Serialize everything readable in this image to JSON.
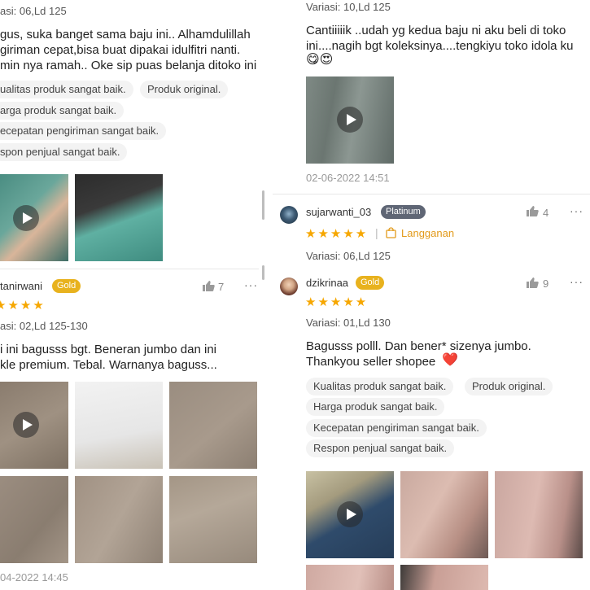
{
  "left_column": {
    "review1": {
      "variation": "asi: 06,Ld 125",
      "text_lines": [
        "gus, suka banget sama baju ini.. Alhamdulillah",
        "giriman cepat,bisa buat dipakai idulfitri nanti.",
        "min nya ramah.. Oke sip puas belanja ditoko ini"
      ],
      "tags": [
        "ualitas produk sangat baik.",
        "Produk original.",
        "arga produk sangat baik.",
        "ecepatan pengiriman sangat baik.",
        "spon penjual sangat baik."
      ]
    },
    "review2": {
      "username": "tanirwani",
      "badge": "Gold",
      "stars": "★★★★",
      "likes": "7",
      "more": "···",
      "variation": "asi: 02,Ld 125-130",
      "text_lines": [
        "i ini bagusss bgt. Beneran jumbo dan ini",
        "kle premium. Tebal. Warnanya baguss..."
      ],
      "timestamp": "04-2022 14:45"
    }
  },
  "right_column": {
    "review1": {
      "variation": "Variasi: 10,Ld 125",
      "text_lines": [
        "Cantiiiiik ..udah yg kedua baju ni aku beli di toko",
        "ini....nagih bgt koleksinya....tengkiyu toko idola ku"
      ],
      "emoji": "😋😍",
      "timestamp": "02-06-2022 14:51"
    },
    "review2": {
      "username": "sujarwanti_03",
      "badge": "Platinum",
      "stars": "★★★★★",
      "separator": "|",
      "subscription_label": "Langganan",
      "likes": "4",
      "more": "···",
      "variation": "Variasi: 06,Ld 125"
    },
    "review3": {
      "username": "dzikrinaa",
      "badge": "Gold",
      "stars": "★★★★★",
      "likes": "9",
      "more": "···",
      "variation": "Variasi: 01,Ld 130",
      "text_lines": [
        "Bagusss polll. Dan bener* sizenya jumbo.",
        "Thankyou seller shopee"
      ],
      "heart": "❤️",
      "tags": [
        "Kualitas produk sangat baik.",
        "Produk original.",
        "Harga produk sangat baik.",
        "Kecepatan pengiriman sangat baik.",
        "Respon penjual sangat baik."
      ]
    }
  },
  "colors": {
    "gold_badge": "#e8b21e",
    "platinum_badge": "#5f6675",
    "star": "#f6a700",
    "subscription": "#e29a1a"
  },
  "icons": [
    "play-icon",
    "thumbs-up-icon",
    "more-options-icon",
    "shop-bag-icon"
  ]
}
